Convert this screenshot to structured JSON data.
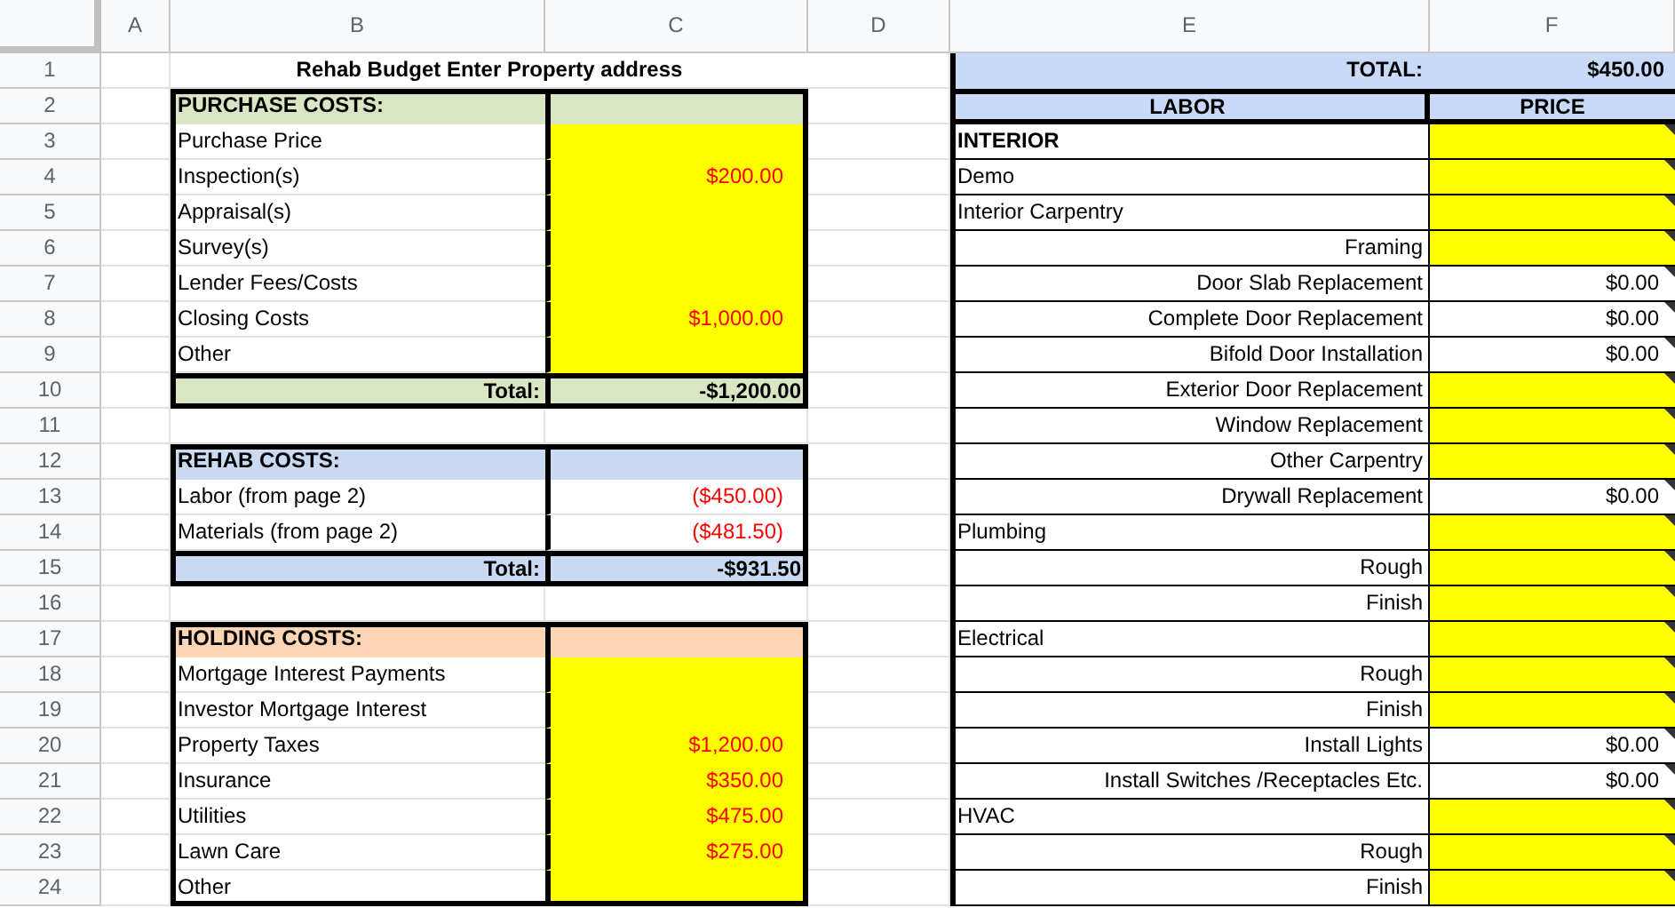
{
  "column_headers": [
    "A",
    "B",
    "C",
    "D",
    "E",
    "F"
  ],
  "row_numbers": [
    "1",
    "2",
    "3",
    "4",
    "5",
    "6",
    "7",
    "8",
    "9",
    "10",
    "11",
    "12",
    "13",
    "14",
    "15",
    "16",
    "17",
    "18",
    "19",
    "20",
    "21",
    "22",
    "23",
    "24"
  ],
  "title": "Rehab Budget Enter Property address",
  "sections": [
    {
      "heading": "PURCHASE COSTS:",
      "color": "#d9e6c4",
      "items": [
        {
          "label": "Purchase Price",
          "input": true
        },
        {
          "label": "Inspection(s)",
          "value": "$200.00",
          "input": true
        },
        {
          "label": "Appraisal(s)",
          "input": true
        },
        {
          "label": "Survey(s)",
          "input": true
        },
        {
          "label": "Lender Fees/Costs",
          "input": true
        },
        {
          "label": "Closing Costs",
          "value": "$1,000.00",
          "input": true
        },
        {
          "label": "Other",
          "input": true
        }
      ],
      "total": {
        "label": "Total:",
        "value": "-$1,200.00"
      }
    },
    {
      "heading": "REHAB COSTS:",
      "color": "#c9daf2",
      "items": [
        {
          "label": "Labor (from page 2)",
          "value": "($450.00)",
          "input": false
        },
        {
          "label": "Materials (from page 2)",
          "value": "($481.50)",
          "input": false
        }
      ],
      "total": {
        "label": "Total:",
        "value": "-$931.50"
      }
    },
    {
      "heading": "HOLDING COSTS:",
      "color": "#fcd5b5",
      "items": [
        {
          "label": "Mortgage Interest Payments",
          "input": true
        },
        {
          "label": "Investor Mortgage Interest",
          "input": true
        },
        {
          "label": "Property Taxes",
          "value": "$1,200.00",
          "input": true
        },
        {
          "label": "Insurance",
          "value": "$350.00",
          "input": true
        },
        {
          "label": "Utilities",
          "value": "$475.00",
          "input": true
        },
        {
          "label": "Lawn Care",
          "value": "$275.00",
          "input": true
        },
        {
          "label": "Other",
          "input": true
        }
      ]
    }
  ],
  "labor_table": {
    "total_label": "TOTAL:",
    "total_value": "$450.00",
    "columns": [
      "LABOR",
      "PRICE"
    ],
    "rows": [
      {
        "kind": "heading",
        "label": "INTERIOR",
        "input": true,
        "note": true
      },
      {
        "kind": "group",
        "label": "Demo",
        "input": true,
        "note": true
      },
      {
        "kind": "group",
        "label": "Interior Carpentry",
        "input": true,
        "note": true
      },
      {
        "kind": "item",
        "label": "Framing",
        "input": true,
        "note": true
      },
      {
        "kind": "item",
        "label": "Door Slab Replacement",
        "value": "$0.00",
        "input": false,
        "note": true
      },
      {
        "kind": "item",
        "label": "Complete Door Replacement",
        "value": "$0.00",
        "input": false,
        "note": true
      },
      {
        "kind": "item",
        "label": "Bifold Door Installation",
        "value": "$0.00",
        "input": false,
        "note": true
      },
      {
        "kind": "item",
        "label": "Exterior Door Replacement",
        "input": true,
        "note": true
      },
      {
        "kind": "item",
        "label": "Window Replacement",
        "input": true,
        "note": true
      },
      {
        "kind": "item",
        "label": "Other Carpentry",
        "input": true,
        "note": true
      },
      {
        "kind": "item",
        "label": "Drywall Replacement",
        "value": "$0.00",
        "input": false,
        "note": true
      },
      {
        "kind": "group",
        "label": "Plumbing",
        "input": true,
        "note": true
      },
      {
        "kind": "item",
        "label": "Rough",
        "input": true,
        "note": true
      },
      {
        "kind": "item",
        "label": "Finish",
        "input": true,
        "note": true
      },
      {
        "kind": "group",
        "label": "Electrical",
        "input": true,
        "note": true
      },
      {
        "kind": "item",
        "label": "Rough",
        "input": true,
        "note": true
      },
      {
        "kind": "item",
        "label": "Finish",
        "input": true,
        "note": true
      },
      {
        "kind": "item",
        "label": "Install Lights",
        "value": "$0.00",
        "input": false,
        "note": true
      },
      {
        "kind": "item",
        "label": "Install Switches /Receptacles Etc.",
        "value": "$0.00",
        "input": false,
        "note": true
      },
      {
        "kind": "group",
        "label": "HVAC",
        "input": true,
        "note": true
      },
      {
        "kind": "item",
        "label": "Rough",
        "input": true,
        "note": true
      },
      {
        "kind": "item",
        "label": "Finish",
        "input": true,
        "note": true
      }
    ]
  }
}
